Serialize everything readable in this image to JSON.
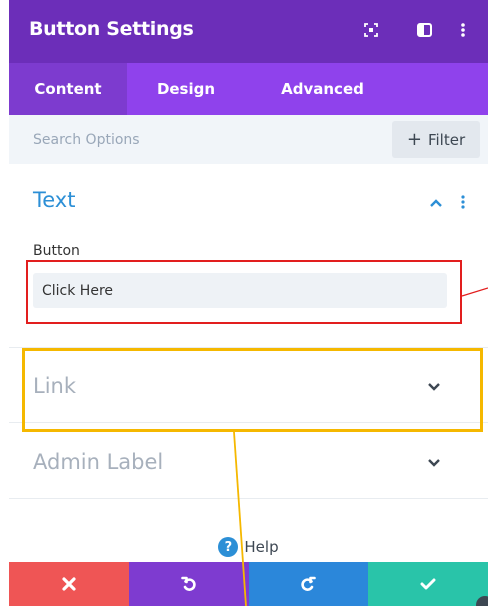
{
  "header": {
    "title": "Button Settings",
    "icons": [
      "screenshot-icon",
      "sidebar-toggle-icon",
      "more-vertical-icon"
    ]
  },
  "tabs": [
    {
      "label": "Content",
      "active": true
    },
    {
      "label": "Design",
      "active": false
    },
    {
      "label": "Advanced",
      "active": false
    }
  ],
  "search": {
    "placeholder": "Search Options",
    "filter_label": "Filter"
  },
  "sections": {
    "text": {
      "title": "Text",
      "field_label": "Button",
      "field_value": "Click Here",
      "expanded": true
    },
    "link": {
      "title": "Link",
      "expanded": false
    },
    "admin_label": {
      "title": "Admin Label",
      "expanded": false
    }
  },
  "help": {
    "label": "Help"
  },
  "footer": {
    "buttons": [
      {
        "icon": "close-icon",
        "color": "#ef5555"
      },
      {
        "icon": "undo-icon",
        "color": "#7e3bd0"
      },
      {
        "icon": "redo-icon",
        "color": "#2b87da"
      },
      {
        "icon": "check-icon",
        "color": "#29c4a9"
      }
    ]
  },
  "colors": {
    "header": "#6c2eb9",
    "tabs": "#8f42ec",
    "accent_blue": "#2c8fd6",
    "annotation_red": "#e21e1e",
    "annotation_yellow": "#f5b800"
  }
}
